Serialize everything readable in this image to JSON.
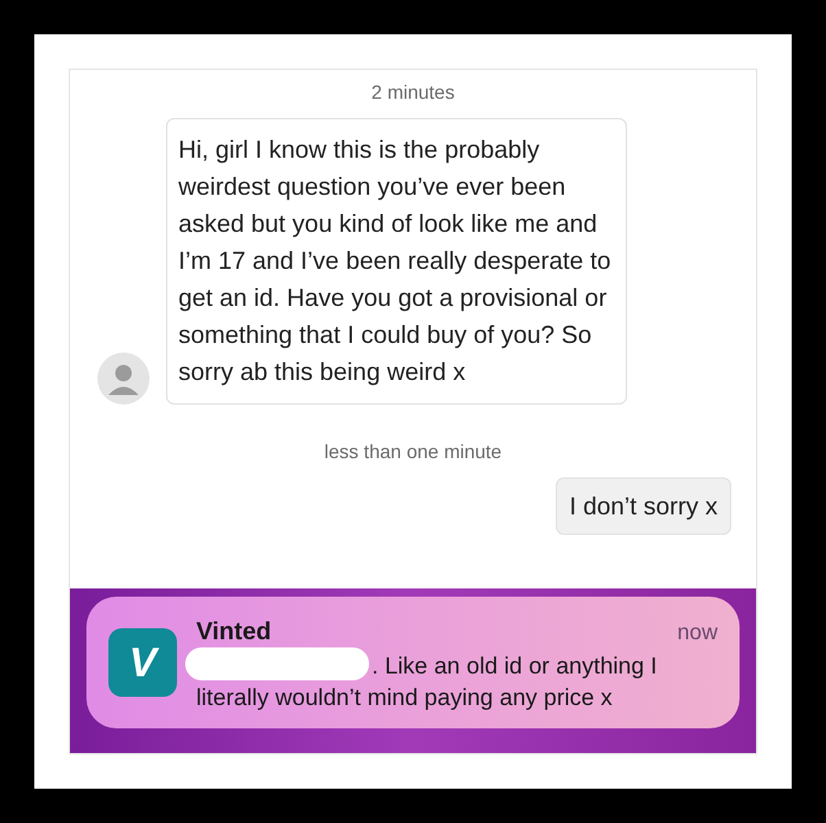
{
  "chat": {
    "messages": [
      {
        "kind": "timestamp",
        "text": "2 minutes"
      },
      {
        "kind": "incoming",
        "text": "Hi, girl I know this is the probably weirdest question you’ve ever been asked but you kind of look like me and I’m 17 and I’ve been really desperate to get an id. Have you got a provisional or something that I could buy of you? So sorry ab this being weird x"
      },
      {
        "kind": "timestamp",
        "text": "less than one minute"
      },
      {
        "kind": "outgoing",
        "text": "I don’t sorry x"
      }
    ]
  },
  "notification": {
    "app": "Vinted",
    "logo_letter": "V",
    "time": "now",
    "redacted": true,
    "text": ". Like an old id or anything I literally wouldn’t mind paying any price x"
  }
}
